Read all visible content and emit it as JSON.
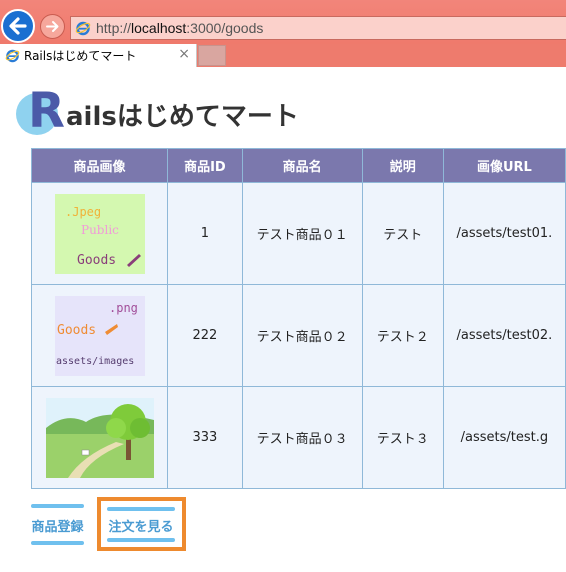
{
  "browser": {
    "url_prefix": "http://",
    "url_host": "localhost",
    "url_rest": ":3000/goods",
    "tab_title": "Railsはじめてマート",
    "tab_close": "×"
  },
  "page": {
    "logo_letter": "R",
    "logo_text": "ailsはじめてマート",
    "table": {
      "headers": [
        "商品画像",
        "商品ID",
        "商品名",
        "説明",
        "画像URL"
      ],
      "rows": [
        {
          "image": {
            "kind": "jpeg-thumb",
            "lines": [
              ".Jpeg",
              "Public",
              "Goods"
            ]
          },
          "id": "1",
          "name": "テスト商品０１",
          "desc": "テスト",
          "url": "/assets/test01."
        },
        {
          "image": {
            "kind": "png-thumb",
            "lines": [
              ".png",
              "Goods",
              "assets/images"
            ]
          },
          "id": "222",
          "name": "テスト商品０２",
          "desc": "テスト２",
          "url": "/assets/test02."
        },
        {
          "image": {
            "kind": "landscape-thumb"
          },
          "id": "333",
          "name": "テスト商品０３",
          "desc": "テスト３",
          "url": "/assets/test.g"
        }
      ]
    },
    "links": {
      "register": "商品登録",
      "orders": "注文を見る"
    }
  },
  "colors": {
    "header_bg": "#7b78ad",
    "cell_bg": "#eef4fc",
    "link": "#4a9bd2",
    "highlight": "#ee8a2e"
  }
}
